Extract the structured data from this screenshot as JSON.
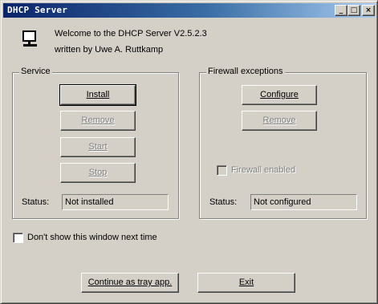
{
  "window": {
    "title": "DHCP Server",
    "controls": [
      "minimize-icon",
      "maximize-icon",
      "close-icon"
    ]
  },
  "header": {
    "icon": "computer-icon",
    "welcome_text": "Welcome to the DHCP Server V2.5.2.3",
    "author_text": "written by Uwe A. Ruttkamp"
  },
  "service": {
    "group_label": "Service",
    "buttons": {
      "install": "Install",
      "remove": "Remove",
      "start": "Start",
      "stop": "Stop"
    },
    "status_label": "Status:",
    "status_value": "Not installed"
  },
  "firewall": {
    "group_label": "Firewall exceptions",
    "buttons": {
      "configure": "Configure",
      "remove": "Remove"
    },
    "checkbox_label": "Firewall enabled",
    "checkbox_checked": false,
    "status_label": "Status:",
    "status_value": "Not configured"
  },
  "options": {
    "dont_show_label": "Don't show this window next time",
    "dont_show_checked": false
  },
  "footer": {
    "tray_button": "Continue as tray app.",
    "exit_button": "Exit"
  },
  "colors": {
    "face": "#d4d0c8",
    "title_start": "#0a246a",
    "title_end": "#a6caf0",
    "disabled_text": "#808080"
  }
}
